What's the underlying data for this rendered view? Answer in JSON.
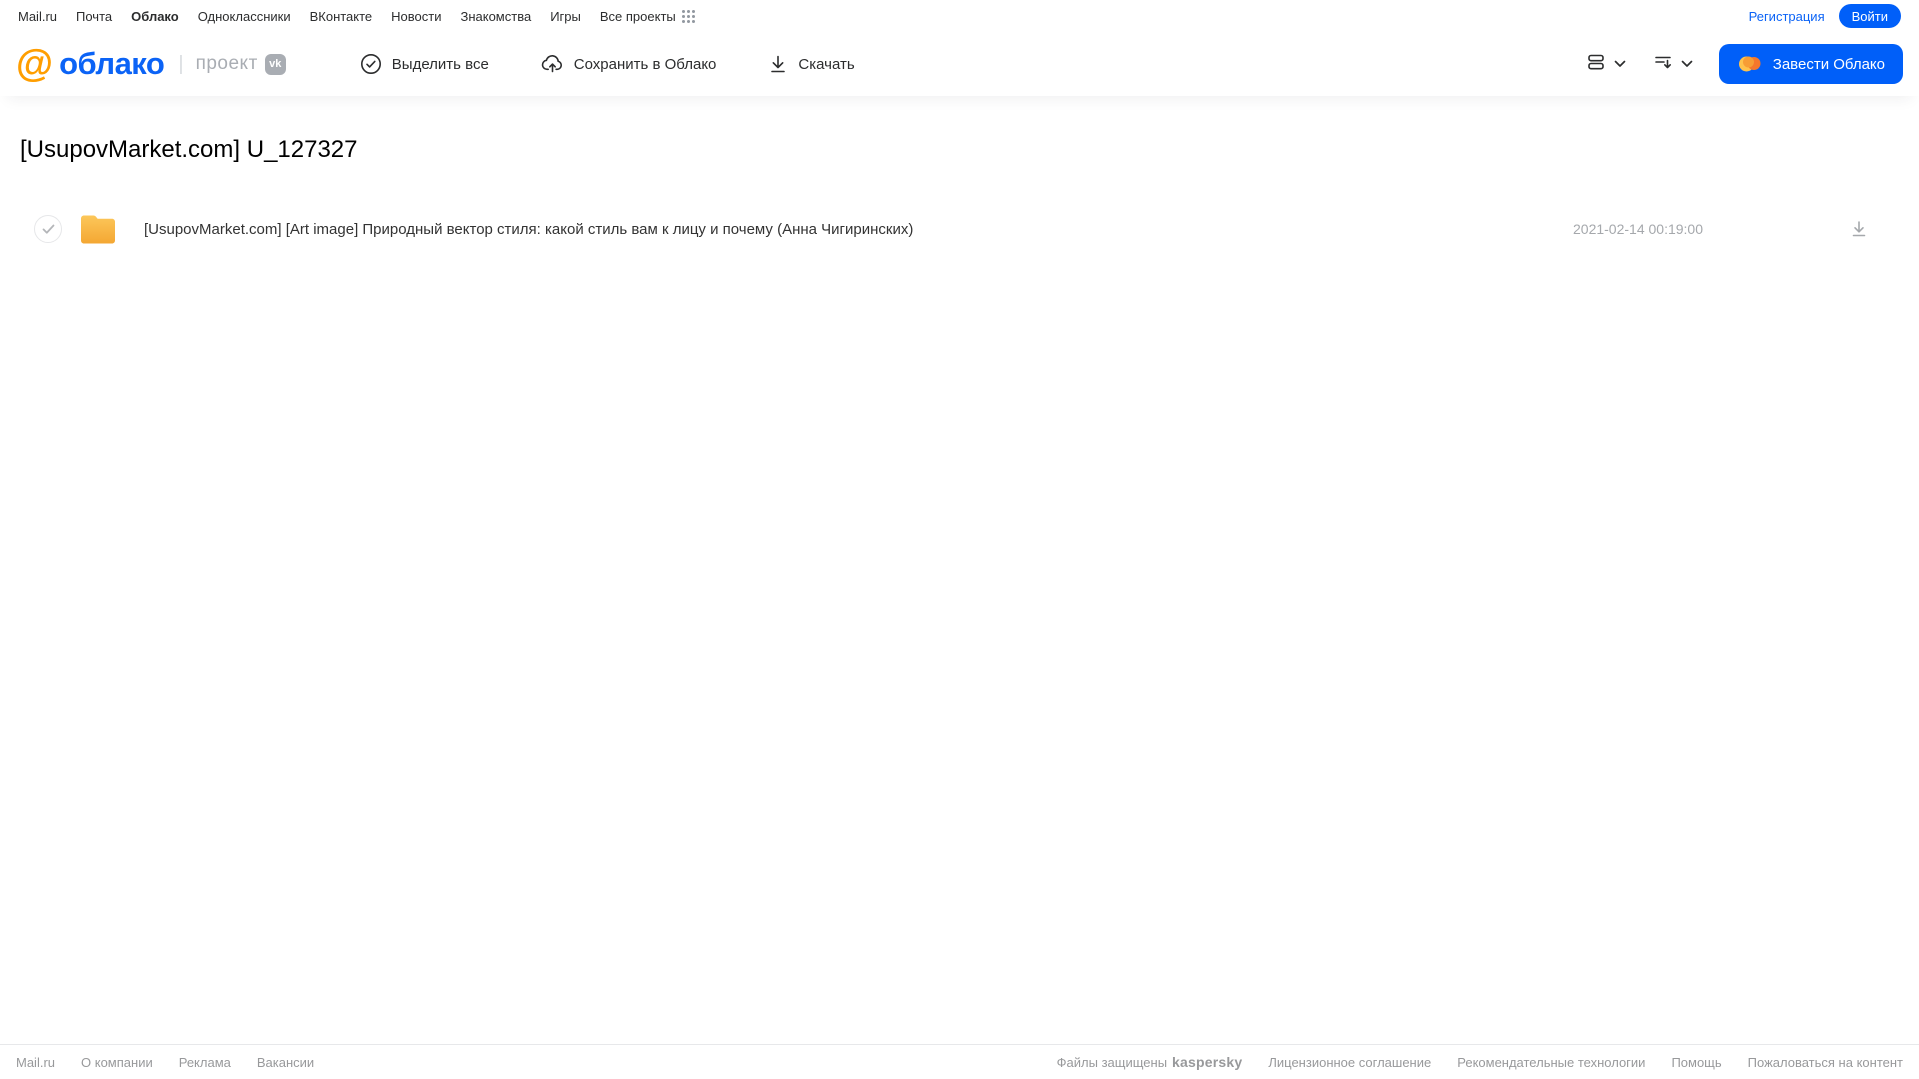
{
  "topnav": {
    "links": [
      "Mail.ru",
      "Почта",
      "Облако",
      "Одноклассники",
      "ВКонтакте",
      "Новости",
      "Знакомства",
      "Игры",
      "Все проекты"
    ],
    "registration": "Регистрация",
    "login": "Войти"
  },
  "header": {
    "logo_at": "@",
    "logo_word": "облако",
    "project_label": "проект",
    "vk_badge": "vk",
    "toolbar": {
      "select_all": "Выделить все",
      "save_to_cloud": "Сохранить в Облако",
      "download": "Скачать"
    },
    "create_cloud": "Завести Облако"
  },
  "main": {
    "title": "[UsupovMarket.com] U_127327",
    "files": [
      {
        "name": "[UsupovMarket.com] [Art image] Природный вектор стиля: какой стиль вам к лицу и почему (Анна Чигиринских)",
        "date": "2021-02-14 00:19:00",
        "type": "folder"
      }
    ]
  },
  "footer": {
    "left_links": [
      "Mail.ru",
      "О компании",
      "Реклама",
      "Вакансии"
    ],
    "protected_by": "Файлы защищены",
    "kaspersky": "kaspersky",
    "right_links": [
      "Лицензионное соглашение",
      "Рекомендательные технологии",
      "Помощь",
      "Пожаловаться на контент"
    ]
  },
  "colors": {
    "accent_blue": "#005ff9",
    "logo_orange": "#ff9e00",
    "folder_orange": "#f6b23c",
    "kaspersky_green": "#006d63",
    "muted_gray": "#a5a8ac"
  }
}
